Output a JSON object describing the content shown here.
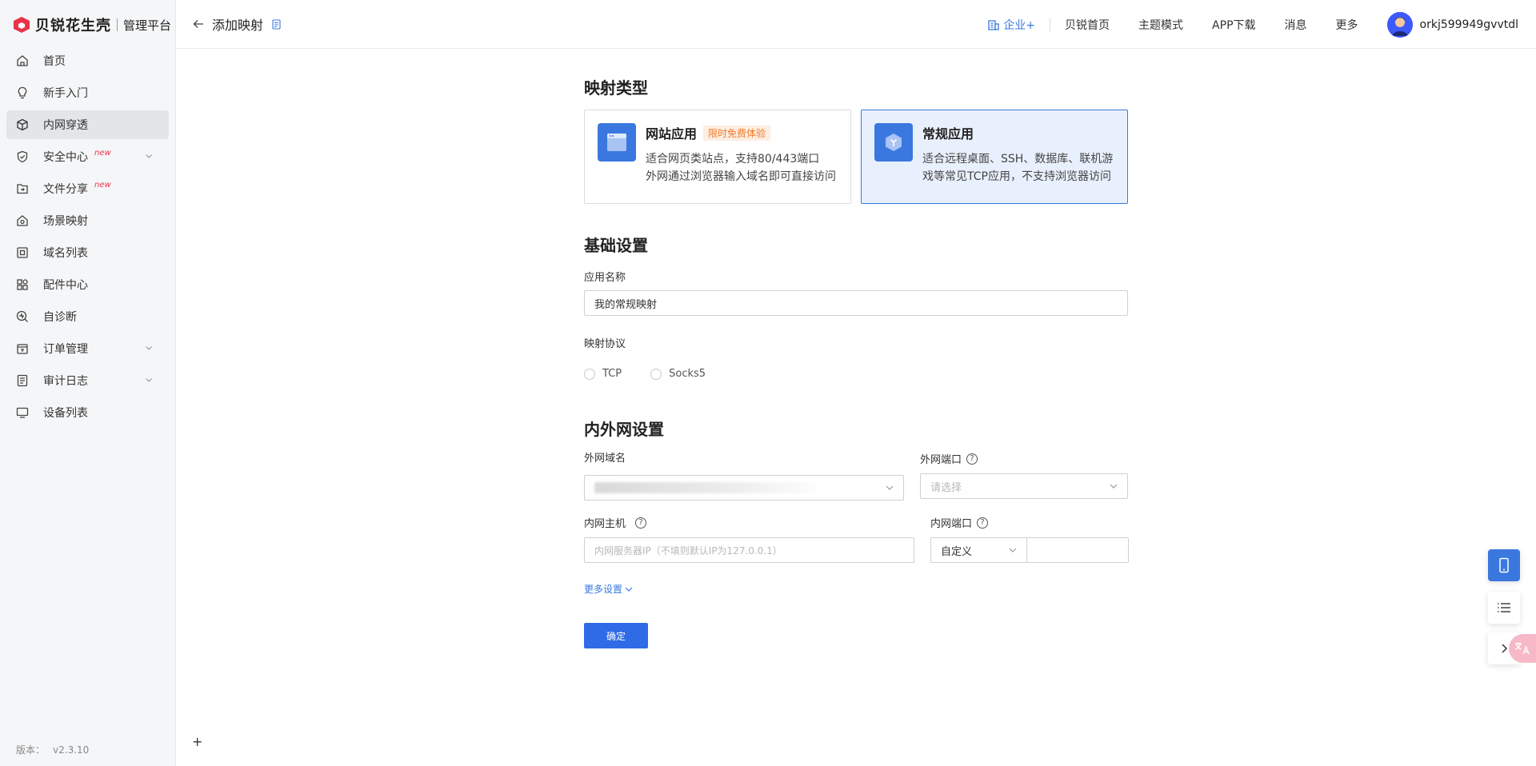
{
  "brand": {
    "name": "贝锐花生壳",
    "sub": "管理平台",
    "accent": "#e8334a"
  },
  "sidebar": {
    "items": [
      {
        "label": "首页",
        "icon": "home-icon"
      },
      {
        "label": "新手入门",
        "icon": "bulb-icon"
      },
      {
        "label": "内网穿透",
        "icon": "cube-icon",
        "active": true
      },
      {
        "label": "安全中心",
        "icon": "shield-icon",
        "badge": "new",
        "expandable": true
      },
      {
        "label": "文件分享",
        "icon": "folder-share-icon",
        "badge": "new"
      },
      {
        "label": "场景映射",
        "icon": "scene-icon"
      },
      {
        "label": "域名列表",
        "icon": "domain-icon"
      },
      {
        "label": "配件中心",
        "icon": "grid-icon"
      },
      {
        "label": "自诊断",
        "icon": "diagnose-icon"
      },
      {
        "label": "订单管理",
        "icon": "order-icon",
        "expandable": true
      },
      {
        "label": "审计日志",
        "icon": "log-icon",
        "expandable": true
      },
      {
        "label": "设备列表",
        "icon": "device-icon"
      }
    ],
    "version_label": "版本：",
    "version": "v2.3.10"
  },
  "header": {
    "title": "添加映射",
    "enterprise": "企业+",
    "links": [
      "贝锐首页",
      "主题模式",
      "APP下载",
      "消息",
      "更多"
    ],
    "username": "orkj599949gvvtdl"
  },
  "mapping_type": {
    "title": "映射类型",
    "cards": [
      {
        "title": "网站应用",
        "badge": "限时免费体验",
        "desc1": "适合网页类站点，支持80/443端口",
        "desc2": "外网通过浏览器输入域名即可直接访问",
        "selected": false
      },
      {
        "title": "常规应用",
        "desc1": "适合远程桌面、SSH、数据库、联机游",
        "desc2": "戏等常见TCP应用，不支持浏览器访问",
        "selected": true
      }
    ]
  },
  "basic": {
    "title": "基础设置",
    "app_name_label": "应用名称",
    "app_name_value": "我的常规映射",
    "protocol_label": "映射协议",
    "protocols": [
      "TCP",
      "Socks5"
    ]
  },
  "network": {
    "title": "内外网设置",
    "ext_domain_label": "外网域名",
    "ext_port_label": "外网端口",
    "ext_port_placeholder": "请选择",
    "int_host_label": "内网主机",
    "int_host_placeholder": "内网服务器IP（不填则默认IP为127.0.0.1）",
    "int_port_label": "内网端口",
    "int_port_mode": "自定义",
    "more_settings": "更多设置",
    "confirm": "确定"
  },
  "misc": {
    "plus": "+"
  }
}
